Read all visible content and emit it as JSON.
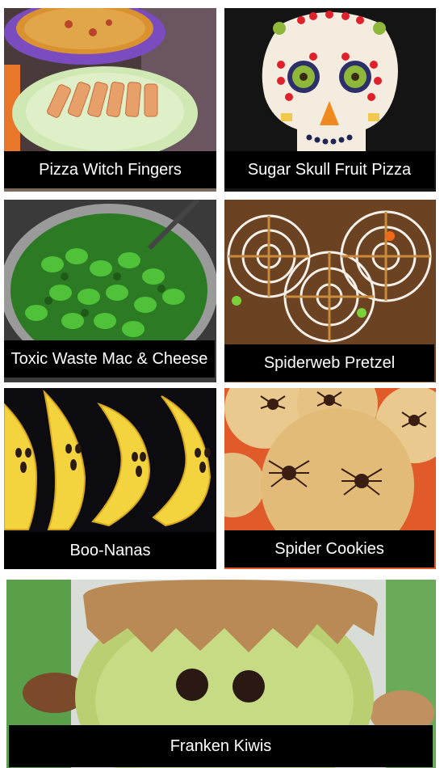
{
  "collage": {
    "items": [
      {
        "caption": "Pizza Witch Fingers",
        "image": "pizza-witch-fingers-photo"
      },
      {
        "caption": "Sugar Skull Fruit Pizza",
        "image": "sugar-skull-fruit-pizza-photo"
      },
      {
        "caption": "Toxic Waste Mac & Cheese",
        "image": "toxic-waste-mac-cheese-photo"
      },
      {
        "caption": "Spiderweb Pretzel",
        "image": "spiderweb-pretzel-photo"
      },
      {
        "caption": "Boo-Nanas",
        "image": "boo-nanas-photo"
      },
      {
        "caption": "Spider Cookies",
        "image": "spider-cookies-photo"
      },
      {
        "caption": "Franken Kiwis",
        "image": "franken-kiwis-photo"
      }
    ]
  }
}
